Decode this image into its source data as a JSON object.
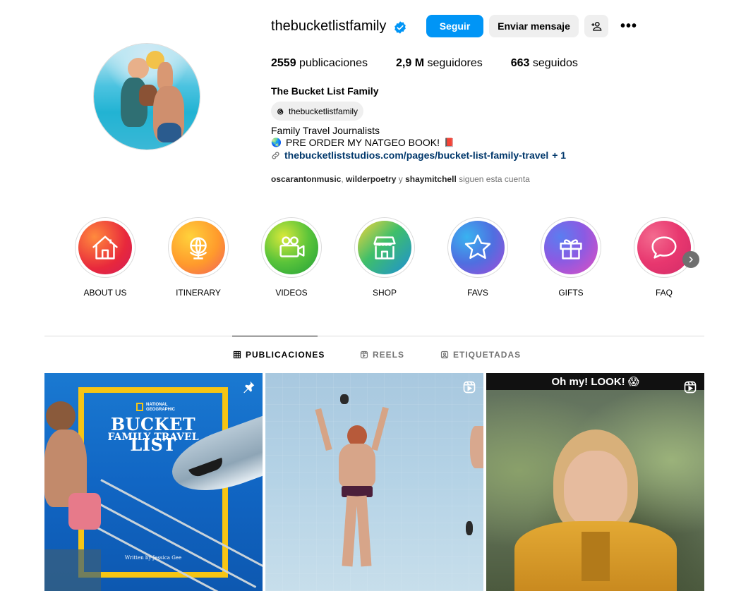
{
  "profile": {
    "username": "thebucketlistfamily",
    "verified": true,
    "follow_label": "Seguir",
    "message_label": "Enviar mensaje",
    "suggest_icon": "person-plus-icon",
    "more_icon": "ellipsis-icon",
    "more_label": "•••"
  },
  "stats": {
    "posts_count": "2559",
    "posts_label": " publicaciones",
    "followers_count": "2,9 M",
    "followers_label": " seguidores",
    "following_count": "663",
    "following_label": " seguidos"
  },
  "bio": {
    "full_name": "The Bucket List Family",
    "threads_handle": "thebucketlistfamily",
    "line1": "Family Travel Journalists",
    "line2_emoji": "🌏",
    "line2_text": "PRE ORDER MY NATGEO BOOK!",
    "line2_emoji_end": "📕",
    "link": "thebucketliststudios.com/pages/bucket-list-family-travel",
    "link_extra": "+ 1"
  },
  "followed_by": {
    "user1": "oscarantonmusic",
    "sep1": ", ",
    "user2": "wilderpoetry",
    "sep2": " y ",
    "user3": "shaymitchell",
    "suffix": " siguen esta cuenta"
  },
  "highlights": [
    {
      "label": "ABOUT US",
      "icon": "house-icon"
    },
    {
      "label": "ITINERARY",
      "icon": "globe-icon"
    },
    {
      "label": "VIDEOS",
      "icon": "video-camera-icon"
    },
    {
      "label": "SHOP",
      "icon": "store-icon"
    },
    {
      "label": "FAVS",
      "icon": "star-icon"
    },
    {
      "label": "GIFTS",
      "icon": "gift-icon"
    },
    {
      "label": "FAQ",
      "icon": "speech-bubble-icon"
    }
  ],
  "tabs": {
    "posts": "PUBLICACIONES",
    "reels": "REELS",
    "tagged": "ETIQUETADAS"
  },
  "posts": [
    {
      "type": "pinned",
      "cover_title": "BUCKET LIST",
      "cover_subtitle": "FAMILY TRAVEL",
      "publisher": "NATIONAL GEOGRAPHIC",
      "byline": "Written by Jessica Gee"
    },
    {
      "type": "reel"
    },
    {
      "type": "reel",
      "caption": "Oh my! LOOK! 😱"
    }
  ],
  "colors": {
    "primary_button": "#0095f6",
    "secondary_button": "#efefef",
    "link": "#00376b",
    "verified_badge": "#0095f6"
  }
}
